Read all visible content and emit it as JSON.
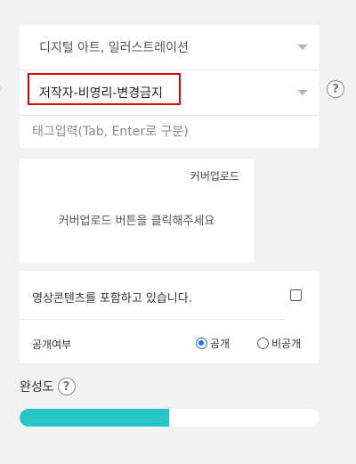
{
  "category": {
    "selected": "디지털 아트, 일러스트레이션"
  },
  "license": {
    "selected": "저작자-비영리-변경금지"
  },
  "help_icon_glyph": "?",
  "tags": {
    "placeholder": "태그입력(Tab, Enter로 구분)"
  },
  "cover": {
    "upload_label": "커버업로드",
    "hint": "커버업로드 버튼을 클릭해주세요"
  },
  "options": {
    "video_label": "영상콘텐츠를 포함하고 있습니다.",
    "video_checked": false,
    "visibility_label": "공개여부",
    "visibility_options": [
      "공개",
      "비공개"
    ],
    "visibility_selected": "공개"
  },
  "progress": {
    "label": "완성도",
    "percent": 50
  },
  "colors": {
    "accent": "#28c4c8",
    "highlight": "#e60000",
    "radio": "#1a73e8"
  }
}
